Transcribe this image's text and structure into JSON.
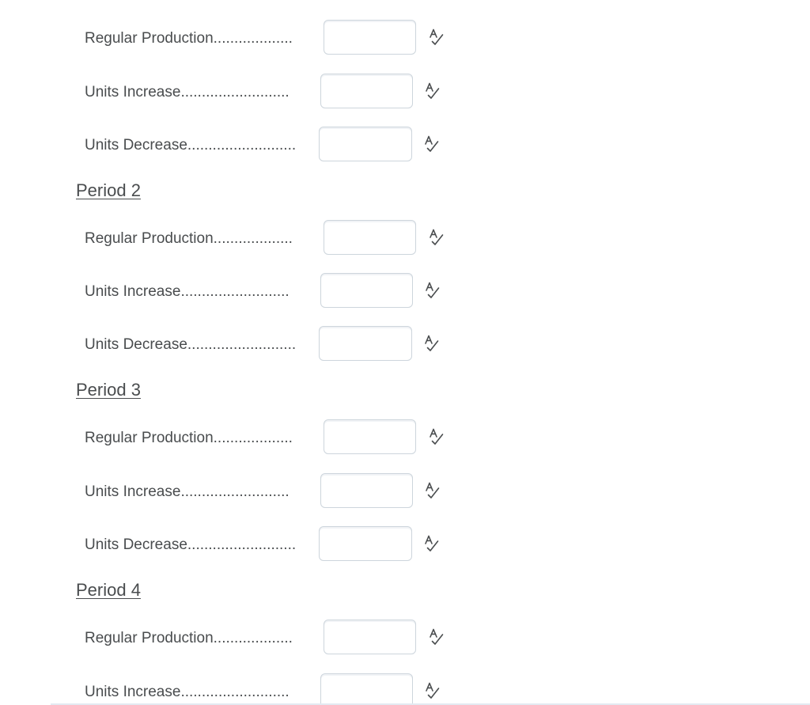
{
  "labels": {
    "regular_production": "Regular Production...................",
    "units_increase": "Units Increase..........................",
    "units_decrease": "Units Decrease.........................."
  },
  "headings": {
    "period_2": "Period 2",
    "period_3": "Period 3",
    "period_4": "Period 4"
  },
  "icons": {
    "spell_check": "spell-check-icon"
  },
  "inputs": {
    "value": "",
    "placeholder": ""
  }
}
